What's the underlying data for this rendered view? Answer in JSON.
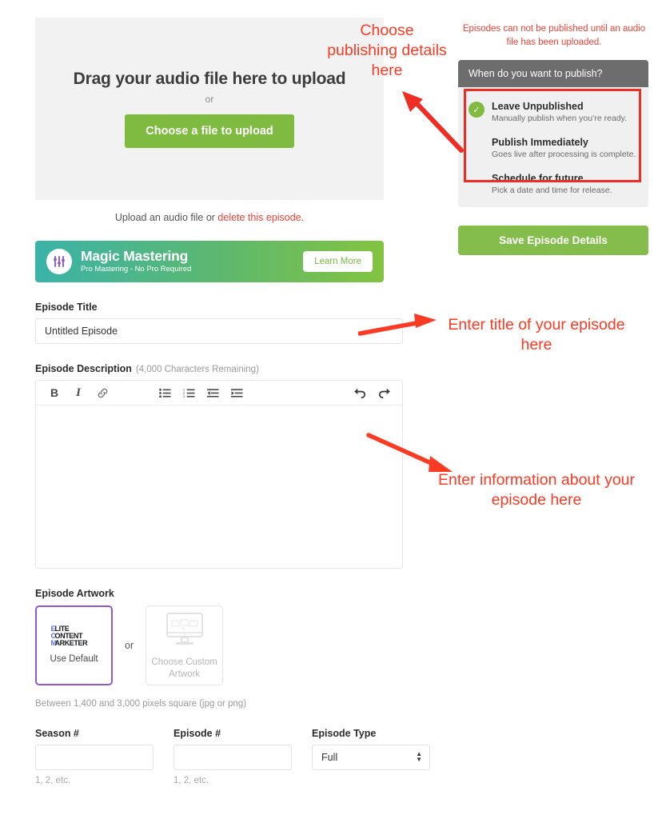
{
  "upload": {
    "drop_title": "Drag your audio file here to upload",
    "or": "or",
    "choose_file_button": "Choose a file to upload",
    "note_prefix": "Upload an audio file or ",
    "note_link": "delete this episode."
  },
  "banner": {
    "title": "Magic Mastering",
    "subtitle": "Pro Mastering - No Pro Required",
    "button": "Learn More",
    "icon": "equalizer-sliders-icon"
  },
  "episode_title": {
    "label": "Episode Title",
    "value": "Untitled Episode"
  },
  "episode_description": {
    "label": "Episode Description",
    "counter": "(4,000 Characters Remaining)",
    "value": "",
    "toolbar": [
      {
        "name": "bold-icon",
        "glyph": "B"
      },
      {
        "name": "italic-icon",
        "glyph": "I"
      },
      {
        "name": "link-icon",
        "glyph": "&#128279;"
      },
      {
        "name": "bullet-list-icon",
        "glyph": ""
      },
      {
        "name": "numbered-list-icon",
        "glyph": ""
      },
      {
        "name": "outdent-icon",
        "glyph": ""
      },
      {
        "name": "indent-icon",
        "glyph": ""
      },
      {
        "name": "undo-icon",
        "glyph": ""
      },
      {
        "name": "redo-icon",
        "glyph": ""
      }
    ]
  },
  "artwork": {
    "label": "Episode Artwork",
    "default_label": "Use Default",
    "or": "or",
    "custom_label": "Choose Custom Artwork",
    "note": "Between 1,400 and 3,000 pixels square (jpg or png)",
    "logo_stack": "E\nC\nM",
    "logo_lines": [
      "LITE",
      "ONTENT",
      "ARKETER"
    ]
  },
  "bottom_fields": {
    "season": {
      "label": "Season #",
      "value": "",
      "hint": "1, 2, etc."
    },
    "episode": {
      "label": "Episode #",
      "value": "",
      "hint": "1, 2, etc."
    },
    "type": {
      "label": "Episode Type",
      "selected": "Full"
    }
  },
  "publish": {
    "warning": "Episodes can not be published until an audio file has been uploaded.",
    "header": "When do you want to publish?",
    "options": [
      {
        "title": "Leave Unpublished",
        "desc": "Manually publish when you’re ready.",
        "selected": true
      },
      {
        "title": "Publish Immediately",
        "desc": "Goes live after processing is complete.",
        "selected": false
      },
      {
        "title": "Schedule for future",
        "desc": "Pick a date and time for release.",
        "selected": false
      }
    ],
    "save_button": "Save Episode Details"
  },
  "annotations": [
    {
      "text": "Choose publishing details here"
    },
    {
      "text": "Enter title of your episode here"
    },
    {
      "text": "Enter information about your episode here"
    }
  ],
  "colors": {
    "green": "#7fba41",
    "red": "#ef4136",
    "annotation_red": "#fb3b24",
    "purple": "#9158c9",
    "panel_header_gray": "#6d6d6d"
  }
}
